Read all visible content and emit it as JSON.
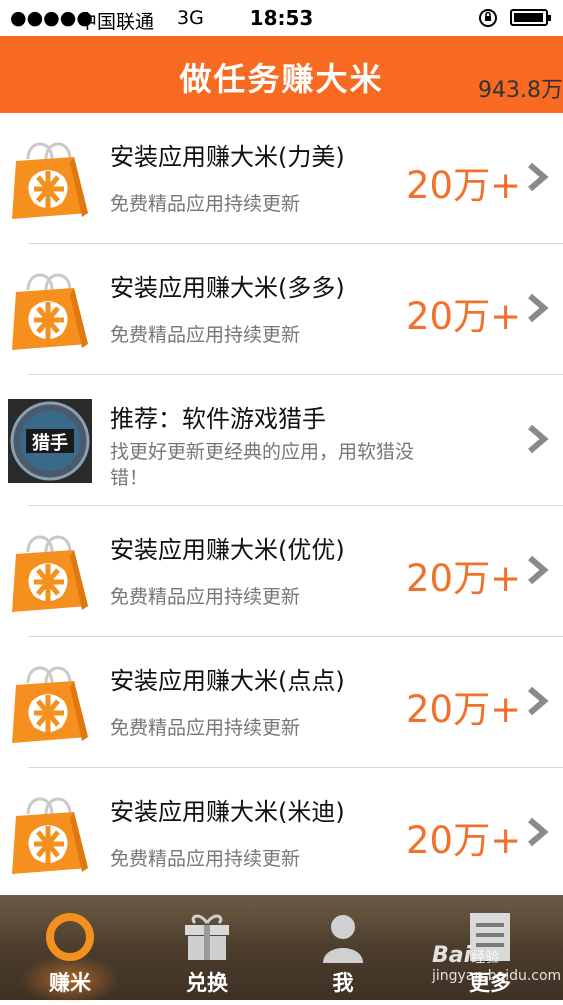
{
  "status_bar": {
    "signal": "●●●●●",
    "carrier": "中国联通",
    "network": "3G",
    "time": "18:53"
  },
  "header": {
    "title": "做任务赚大米",
    "balance": "943.8万"
  },
  "tasks": [
    {
      "icon": "shopping-bag-icon",
      "title": "安装应用赚大米(力美)",
      "desc": "免费精品应用持续更新",
      "reward": "20万+"
    },
    {
      "icon": "shopping-bag-icon",
      "title": "安装应用赚大米(多多)",
      "desc": "免费精品应用持续更新",
      "reward": "20万+"
    },
    {
      "icon": "game-hunter-icon",
      "title": "推荐：软件游戏猎手",
      "desc": "找更好更新更经典的应用，用软猎没错！",
      "reward": "",
      "icon_text": "猎手"
    },
    {
      "icon": "shopping-bag-icon",
      "title": "安装应用赚大米(优优)",
      "desc": "免费精品应用持续更新",
      "reward": "20万+"
    },
    {
      "icon": "shopping-bag-icon",
      "title": "安装应用赚大米(点点)",
      "desc": "免费精品应用持续更新",
      "reward": "20万+"
    },
    {
      "icon": "shopping-bag-icon",
      "title": "安装应用赚大米(米迪)",
      "desc": "免费精品应用持续更新",
      "reward": "20万+"
    }
  ],
  "tab_bar": {
    "tabs": [
      {
        "label": "赚米",
        "icon": "ring-icon",
        "active": true
      },
      {
        "label": "兑换",
        "icon": "gift-icon",
        "active": false
      },
      {
        "label": "我",
        "icon": "user-icon",
        "active": false
      },
      {
        "label": "更多",
        "icon": "list-icon",
        "active": false
      }
    ]
  },
  "watermark": {
    "brand": "Bai",
    "brand_suffix": "经验",
    "site": "jingyan.baidu.com"
  },
  "colors": {
    "accent": "#f86a22",
    "reward": "#f0712b",
    "tabbar": "#4c3d2d"
  }
}
